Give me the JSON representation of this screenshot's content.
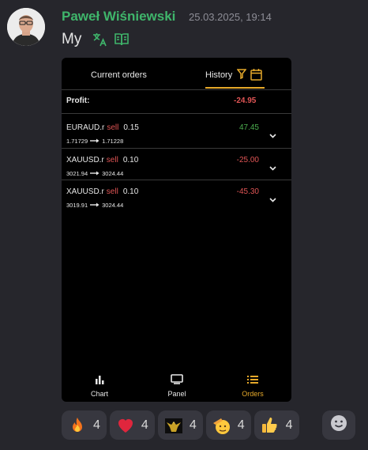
{
  "message": {
    "author": "Paweł Wiśniewski",
    "timestamp": "25.03.2025, 19:14",
    "text": "My",
    "author_color": "#3fb56b"
  },
  "app": {
    "tabs": [
      {
        "label": "Current orders",
        "active": false
      },
      {
        "label": "History",
        "active": true
      }
    ],
    "accent_color": "#e6a92a",
    "negative_color": "#e05555",
    "positive_color": "#4cae4f",
    "profit_label": "Profit:",
    "profit_value": "-24.95",
    "orders": [
      {
        "symbol": "EURAUD.r",
        "side": "sell",
        "volume": "0.15",
        "open_price": "1.71729",
        "close_price": "1.71228",
        "pnl": "47.45",
        "pnl_positive": true
      },
      {
        "symbol": "XAUUSD.r",
        "side": "sell",
        "volume": "0.10",
        "open_price": "3021.94",
        "close_price": "3024.44",
        "pnl": "-25.00",
        "pnl_positive": false
      },
      {
        "symbol": "XAUUSD.r",
        "side": "sell",
        "volume": "0.10",
        "open_price": "3019.91",
        "close_price": "3024.44",
        "pnl": "-45.30",
        "pnl_positive": false
      }
    ],
    "nav": [
      {
        "label": "Chart",
        "icon": "bar-chart-icon",
        "active": false
      },
      {
        "label": "Panel",
        "icon": "monitor-icon",
        "active": false
      },
      {
        "label": "Orders",
        "icon": "list-icon",
        "active": true
      }
    ]
  },
  "reactions": [
    {
      "emoji": "fire-emoji",
      "count": "4"
    },
    {
      "emoji": "red-heart-emoji",
      "count": "4"
    },
    {
      "emoji": "custom-eagle-emoji",
      "count": "4"
    },
    {
      "emoji": "saluting-face-emoji",
      "count": "4"
    },
    {
      "emoji": "thumbs-up-emoji",
      "count": "4"
    }
  ]
}
